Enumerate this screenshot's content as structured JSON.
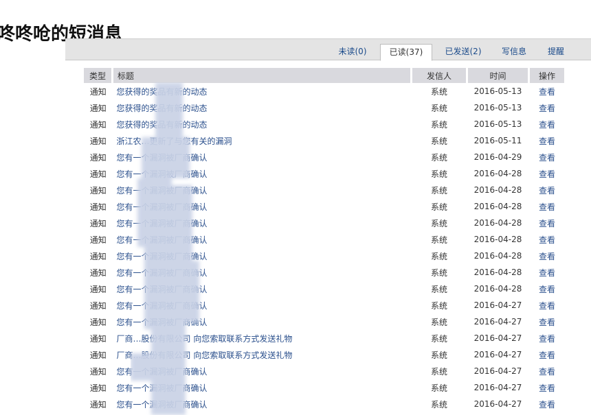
{
  "page": {
    "title": "咚咚呛的短消息"
  },
  "tabs": [
    {
      "label": "未读(0)",
      "active": false
    },
    {
      "label": "已读(37)",
      "active": true
    },
    {
      "label": "已发送(2)",
      "active": false
    },
    {
      "label": "写信息",
      "active": false
    },
    {
      "label": "提醒",
      "active": false
    }
  ],
  "table": {
    "headers": {
      "type": "类型",
      "title": "标题",
      "sender": "发信人",
      "time": "时间",
      "action": "操作"
    },
    "rows": [
      {
        "type": "通知",
        "title": "您获得的奖品有新的动态",
        "sender": "系统",
        "date": "2016-05-13",
        "action": "查看"
      },
      {
        "type": "通知",
        "title": "您获得的奖品有新的动态",
        "sender": "系统",
        "date": "2016-05-13",
        "action": "查看"
      },
      {
        "type": "通知",
        "title": "您获得的奖品有新的动态",
        "sender": "系统",
        "date": "2016-05-13",
        "action": "查看"
      },
      {
        "type": "通知",
        "title": "浙江农…更新了与您有关的漏洞",
        "sender": "系统",
        "date": "2016-05-11",
        "action": "查看"
      },
      {
        "type": "通知",
        "title": "您有一个漏洞被厂商确认",
        "sender": "系统",
        "date": "2016-04-29",
        "action": "查看"
      },
      {
        "type": "通知",
        "title": "您有一个漏洞被厂商确认",
        "sender": "系统",
        "date": "2016-04-28",
        "action": "查看"
      },
      {
        "type": "通知",
        "title": "您有一个漏洞被厂商确认",
        "sender": "系统",
        "date": "2016-04-28",
        "action": "查看"
      },
      {
        "type": "通知",
        "title": "您有一个漏洞被厂商确认",
        "sender": "系统",
        "date": "2016-04-28",
        "action": "查看"
      },
      {
        "type": "通知",
        "title": "您有一个漏洞被厂商确认",
        "sender": "系统",
        "date": "2016-04-28",
        "action": "查看"
      },
      {
        "type": "通知",
        "title": "您有一个漏洞被厂商确认",
        "sender": "系统",
        "date": "2016-04-28",
        "action": "查看"
      },
      {
        "type": "通知",
        "title": "您有一个漏洞被厂商确认",
        "sender": "系统",
        "date": "2016-04-28",
        "action": "查看"
      },
      {
        "type": "通知",
        "title": "您有一个漏洞被厂商确认",
        "sender": "系统",
        "date": "2016-04-28",
        "action": "查看"
      },
      {
        "type": "通知",
        "title": "您有一个漏洞被厂商确认",
        "sender": "系统",
        "date": "2016-04-28",
        "action": "查看"
      },
      {
        "type": "通知",
        "title": "您有一个漏洞被厂商确认",
        "sender": "系统",
        "date": "2016-04-27",
        "action": "查看"
      },
      {
        "type": "通知",
        "title": "您有一个漏洞被厂商确认",
        "sender": "系统",
        "date": "2016-04-27",
        "action": "查看"
      },
      {
        "type": "通知",
        "title": "厂商…股份有限公司 向您索取联系方式发送礼物",
        "sender": "系统",
        "date": "2016-04-27",
        "action": "查看"
      },
      {
        "type": "通知",
        "title": "厂商…股份有限公司 向您索取联系方式发送礼物",
        "sender": "系统",
        "date": "2016-04-27",
        "action": "查看"
      },
      {
        "type": "通知",
        "title": "您有一个漏洞被厂商确认",
        "sender": "系统",
        "date": "2016-04-27",
        "action": "查看"
      },
      {
        "type": "通知",
        "title": "您有一个漏洞被厂商确认",
        "sender": "系统",
        "date": "2016-04-27",
        "action": "查看"
      },
      {
        "type": "通知",
        "title": "您有一个漏洞被厂商确认",
        "sender": "系统",
        "date": "2016-04-27",
        "action": "查看"
      }
    ]
  }
}
